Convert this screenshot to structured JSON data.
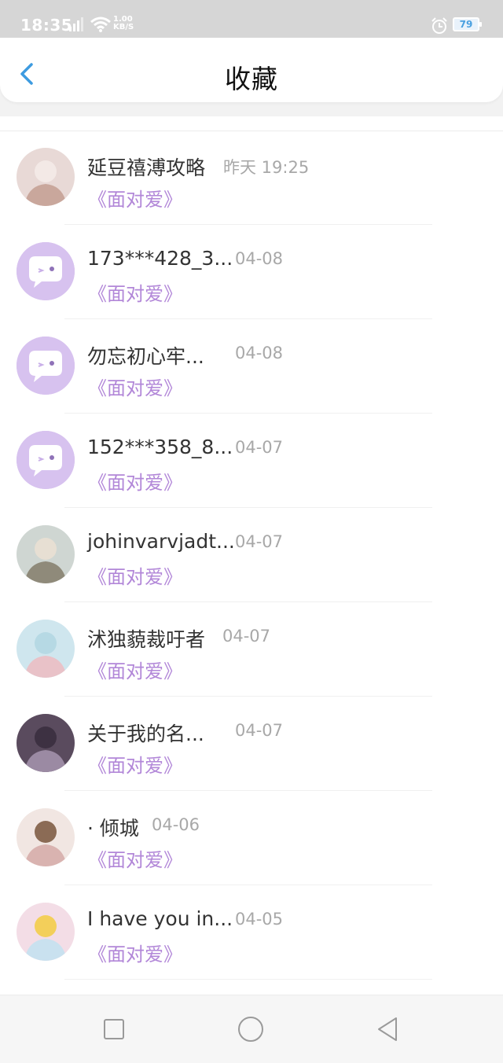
{
  "status_bar": {
    "time": "18:35",
    "network_speed_value": "1.00",
    "network_speed_unit": "KB/S",
    "battery": "79"
  },
  "header": {
    "title": "收藏",
    "back_icon": "chevron-left-icon",
    "accent_color": "#3d9be0"
  },
  "colors": {
    "book_link": "#b287d8",
    "timestamp": "#a8a8a8",
    "default_avatar_bg": "#d7c2ef"
  },
  "items": [
    {
      "name": "延豆禧溥攻略",
      "time": "昨天 19:25",
      "book": "《面对爱》",
      "avatar": "photo"
    },
    {
      "name": "173***428_3...",
      "time": "04-08",
      "book": "《面对爱》",
      "avatar": "default-chat"
    },
    {
      "name": "勿忘初心牢...",
      "time": "04-08",
      "book": "《面对爱》",
      "avatar": "default-chat"
    },
    {
      "name": "152***358_8...",
      "time": "04-07",
      "book": "《面对爱》",
      "avatar": "default-chat"
    },
    {
      "name": "johinvarvjadt...",
      "time": "04-07",
      "book": "《面对爱》",
      "avatar": "photo"
    },
    {
      "name": "沭独藐裁吁者",
      "time": "04-07",
      "book": "《面对爱》",
      "avatar": "photo"
    },
    {
      "name": "关于我的名...",
      "time": "04-07",
      "book": "《面对爱》",
      "avatar": "photo"
    },
    {
      "name": "· 倾城",
      "time": "04-06",
      "book": "《面对爱》",
      "avatar": "illustration"
    },
    {
      "name": "I have you in...",
      "time": "04-05",
      "book": "《面对爱》",
      "avatar": "illustration"
    }
  ],
  "nav_bar": {
    "recents_icon": "square-icon",
    "home_icon": "circle-icon",
    "back_icon": "triangle-back-icon"
  }
}
